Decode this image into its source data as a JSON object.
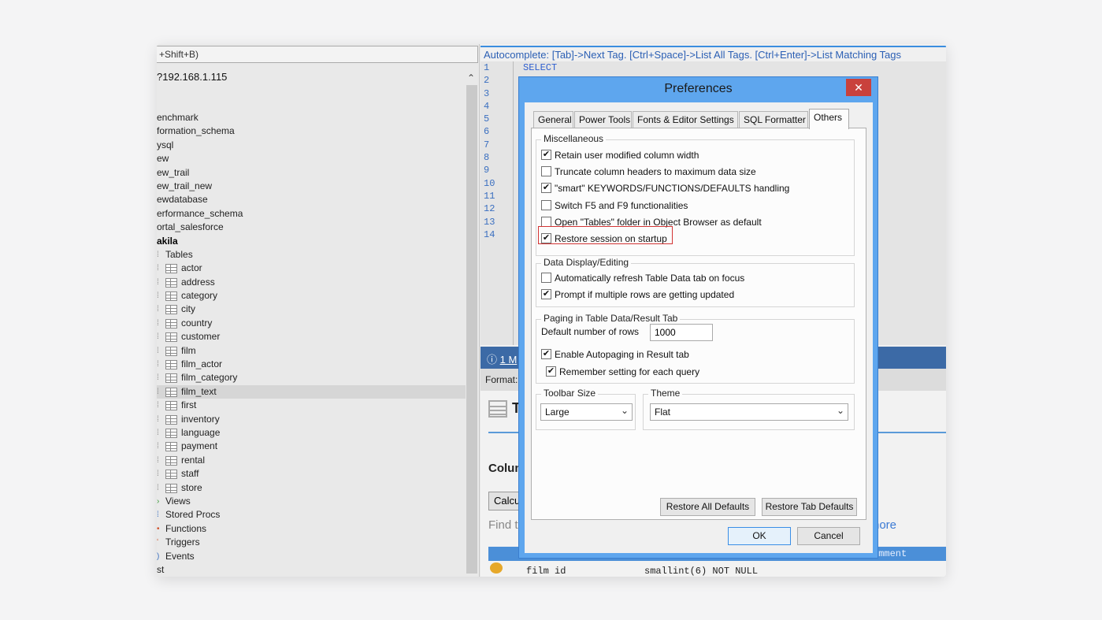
{
  "left": {
    "filter_text": "+Shift+B)",
    "connection": "?192.168.1.115",
    "databases": [
      "enchmark",
      "formation_schema",
      "ysql",
      "ew",
      "ew_trail",
      "ew_trail_new",
      "ewdatabase",
      "erformance_schema",
      "ortal_salesforce"
    ],
    "active_db": "akila",
    "tables_label": "Tables",
    "tables": [
      "actor",
      "address",
      "category",
      "city",
      "country",
      "customer",
      "film",
      "film_actor",
      "film_category",
      "film_text",
      "first",
      "inventory",
      "language",
      "payment",
      "rental",
      "staff",
      "store"
    ],
    "selected_table": "film_text",
    "other_nodes": [
      "Views",
      "Stored Procs",
      "Functions",
      "Triggers",
      "Events"
    ],
    "last_item": "st"
  },
  "editor": {
    "autocomplete": "Autocomplete: [Tab]->Next Tag. [Ctrl+Space]->List All Tags. [Ctrl+Enter]->List Matching Tags",
    "line_numbers": [
      "1",
      "2",
      "3",
      "4",
      "5",
      "6",
      "7",
      "8",
      "9",
      "10",
      "11",
      "12",
      "13",
      "14"
    ],
    "code_line_1": "SELECT",
    "message": "1 M",
    "format_label": "Format:",
    "table_heading": "T",
    "columns_heading": "Colun",
    "calc_button": "Calcu",
    "find_text": "Find t",
    "more_link": "nore",
    "grid_header_comment": "omment",
    "row_col1": "film id",
    "row_col2": "smallint(6) NOT NULL"
  },
  "dialog": {
    "title": "Preferences",
    "close": "✕",
    "tabs": [
      "General",
      "Power Tools",
      "Fonts & Editor Settings",
      "SQL Formatter",
      "Others"
    ],
    "active_tab": "Others",
    "misc": {
      "title": "Miscellaneous",
      "items": [
        {
          "label": "Retain user modified column width",
          "checked": true
        },
        {
          "label": "Truncate column headers to maximum data size",
          "checked": false
        },
        {
          "label": "\"smart\" KEYWORDS/FUNCTIONS/DEFAULTS handling",
          "checked": true
        },
        {
          "label": "Switch F5 and F9 functionalities",
          "checked": false
        },
        {
          "label": "Open \"Tables\" folder in Object Browser as default",
          "checked": false
        },
        {
          "label": "Restore session on startup",
          "checked": true
        }
      ]
    },
    "display": {
      "title": "Data Display/Editing",
      "items": [
        {
          "label": "Automatically refresh Table Data tab on focus",
          "checked": false
        },
        {
          "label": "Prompt if multiple rows are getting updated",
          "checked": true
        }
      ]
    },
    "paging": {
      "title": "Paging in Table Data/Result Tab",
      "rows_label": "Default number of rows",
      "rows_value": "1000",
      "items": [
        {
          "label": "Enable Autopaging in Result tab",
          "checked": true
        },
        {
          "label": "Remember setting for each query",
          "checked": true
        }
      ]
    },
    "toolbar": {
      "title": "Toolbar Size",
      "value": "Large"
    },
    "theme": {
      "title": "Theme",
      "value": "Flat"
    },
    "restore_all": "Restore All Defaults",
    "restore_tab": "Restore Tab Defaults",
    "ok": "OK",
    "cancel": "Cancel"
  }
}
